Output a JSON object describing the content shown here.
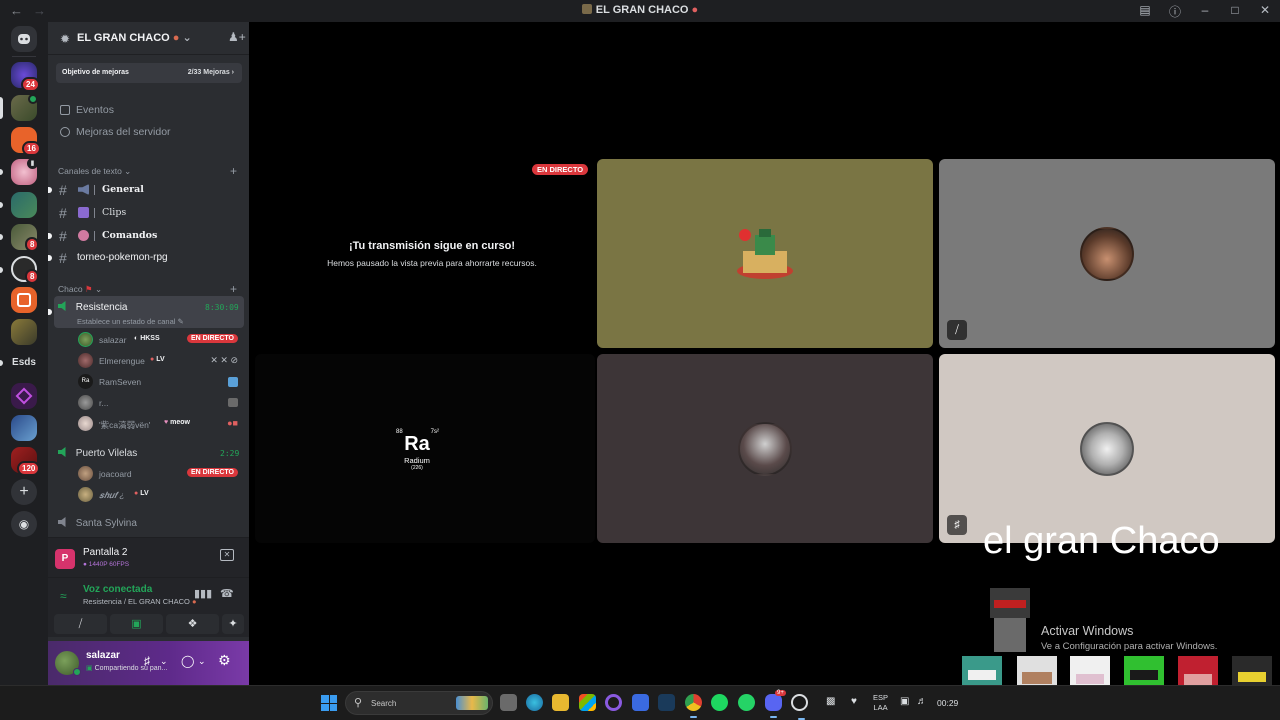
{
  "window": {
    "title": "EL GRAN CHACO",
    "back_icon": "arrow-left-icon",
    "forward_icon": "arrow-right-icon",
    "controls": [
      "inbox-icon",
      "help-icon",
      "minimize-icon",
      "maximize-icon",
      "close-icon"
    ]
  },
  "rail": {
    "servers": [
      {
        "badge": "24"
      },
      {
        "badge": ""
      },
      {
        "badge": "16"
      },
      {
        "badge": ""
      },
      {
        "badge": ""
      },
      {
        "badge": "8"
      },
      {
        "badge": "8"
      },
      {
        "badge": ""
      },
      {
        "badge": ""
      },
      {
        "label": "Esds"
      },
      {
        "badge": ""
      },
      {
        "badge": ""
      },
      {
        "badge": "120"
      }
    ],
    "add_server_icon": "plus-icon",
    "discover_icon": "compass-icon"
  },
  "sidebar": {
    "guild_name": "EL GRAN CHACO",
    "boost": {
      "label": "Objetivo de mejoras",
      "progress": "2/33 Mejoras"
    },
    "nav": [
      {
        "label": "Eventos",
        "icon": "calendar-icon"
      },
      {
        "label": "Mejoras del servidor",
        "icon": "boost-icon"
      }
    ],
    "text_category": "Canales de texto",
    "text_channels": [
      {
        "name": "General",
        "icon": "megaphone-icon"
      },
      {
        "name": "Clips",
        "icon": "film-icon"
      },
      {
        "name": "Comandos",
        "icon": "robot-icon"
      },
      {
        "name": "torneo-pokemon-rpg"
      }
    ],
    "voice_category": "Chaco",
    "voice_channels": [
      {
        "name": "Resistencia",
        "timer": "8:30:09",
        "status": "Establece un estado de canal",
        "users": [
          {
            "name": "salazar",
            "tag": "HKSS",
            "live": "EN DIRECTO"
          },
          {
            "name": "Elmerengue",
            "tag": "LV",
            "icons": "✕ ✕ ⊘"
          },
          {
            "name": "RamSeven"
          },
          {
            "name": "r..."
          },
          {
            "name": "'紫ca滈弱vën'",
            "tag": "meow"
          }
        ]
      },
      {
        "name": "Puerto Vilelas",
        "timer": "2:29",
        "users": [
          {
            "name": "joacoard",
            "live": "EN DIRECTO"
          },
          {
            "name": "𝒔𝒉𝒖𝒇 ¿",
            "tag": "LV"
          }
        ]
      },
      {
        "name": "Santa Sylvina"
      }
    ],
    "stream_panel": {
      "title": "Pantalla 2",
      "quality": "1440P 60FPS"
    },
    "voice_panel": {
      "status": "Voz conectada",
      "location": "Resistencia / EL GRAN CHACO"
    },
    "voice_buttons": [
      "camera-off-icon",
      "screen-share-icon",
      "activities-icon",
      "soundboard-icon"
    ],
    "user_panel": {
      "name": "salazar",
      "status": "Compartiendo su pan..."
    }
  },
  "stage": {
    "live_label": "EN DIRECTO",
    "paused_title": "¡Tu transmisión sigue en curso!",
    "paused_sub": "Hemos pausado la vista previa para ahorrarte recursos.",
    "radium": {
      "number": "88",
      "mass": "7s²",
      "symbol": "Ra",
      "name": "Radium",
      "weight": "(226)"
    },
    "colors": {
      "tile1": "#7a7544",
      "tile2": "#7a7a7a",
      "tile3": "#3d3537",
      "tile4": "#d0c8c2",
      "live": "#da373c",
      "accent": "#23a559"
    }
  },
  "overlay": {
    "watermark": "el gran Chaco",
    "activate_title": "Activar Windows",
    "activate_sub": "Ve a Configuración para activar Windows."
  },
  "taskbar": {
    "search_placeholder": "Search",
    "apps": [
      "file-explorer-icon",
      "edge-icon",
      "folder-icon",
      "store-icon",
      "cortana-icon",
      "app-icon",
      "steam-icon",
      "chrome-icon",
      "spotify-icon",
      "whatsapp-icon",
      "discord-icon",
      "obs-icon"
    ],
    "discord_badge": "9+",
    "lang_top": "ESP",
    "lang_bottom": "LAA",
    "time": "00:29"
  }
}
